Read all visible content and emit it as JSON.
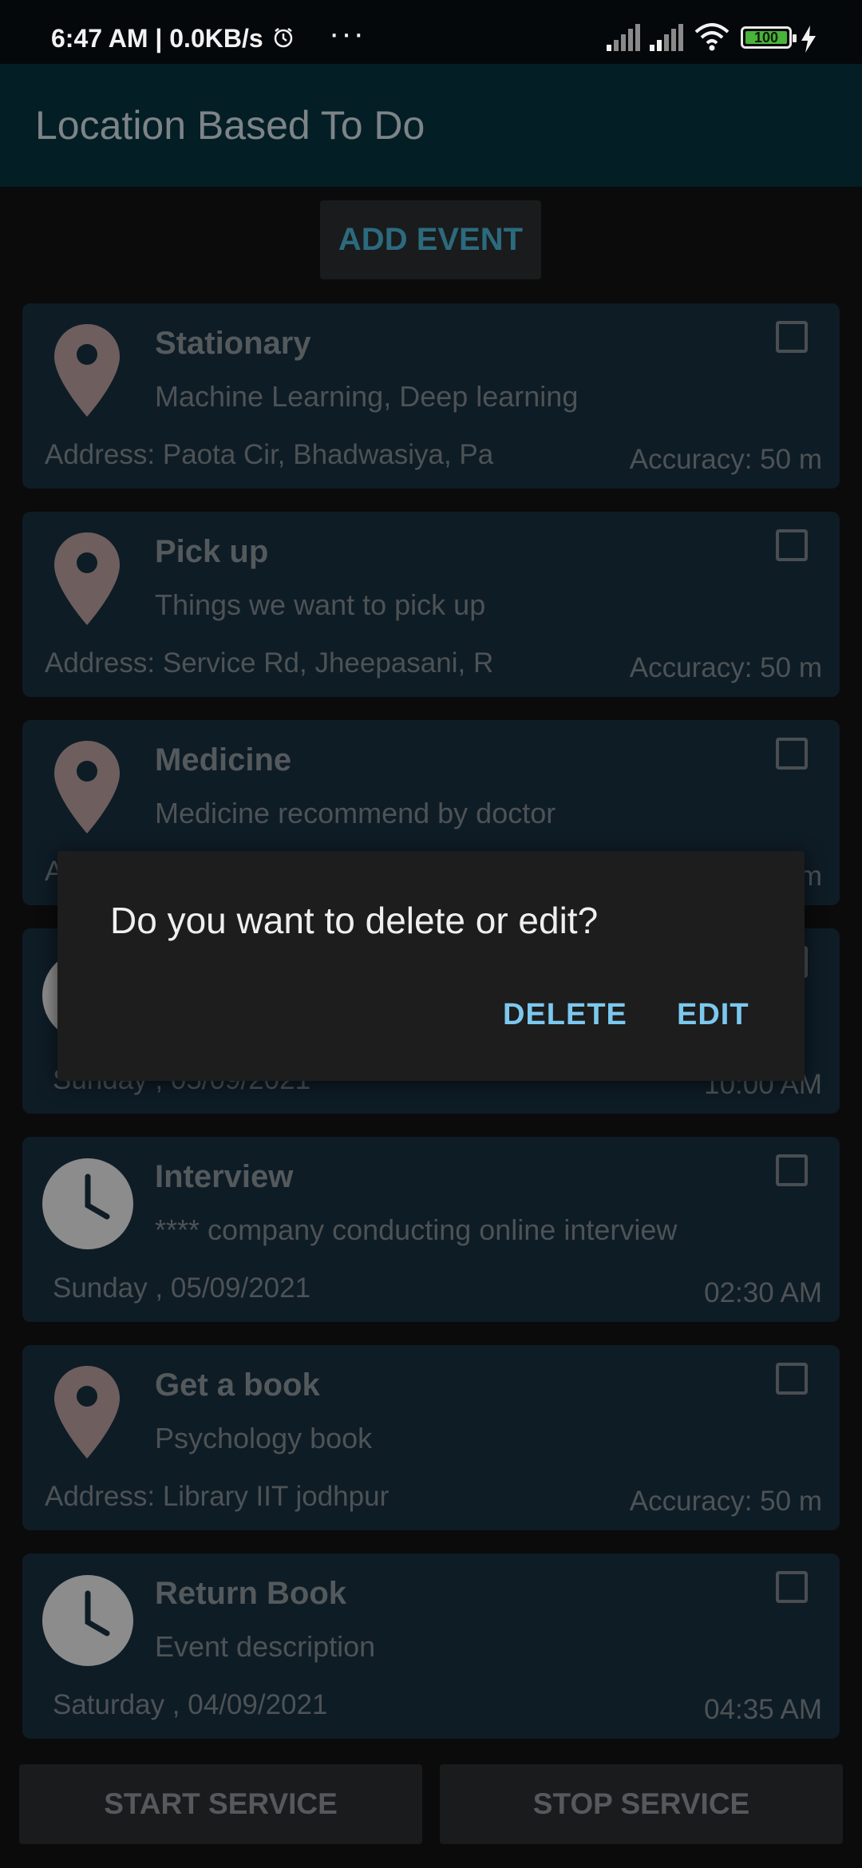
{
  "status_bar": {
    "time": "6:47 AM | 0.0KB/s",
    "dots": "···",
    "battery": "100"
  },
  "app_bar": {
    "title": "Location Based To Do"
  },
  "add_event_label": "ADD EVENT",
  "events": [
    {
      "kind": "location",
      "title": "Stationary",
      "description": "Machine Learning, Deep learning",
      "left": "Address: Paota Cir, Bhadwasiya, Pa",
      "right": "Accuracy: 50 m"
    },
    {
      "kind": "location",
      "title": "Pick up",
      "description": "Things we want to pick up",
      "left": "Address: Service Rd, Jheepasani, R",
      "right": "Accuracy: 50 m"
    },
    {
      "kind": "location",
      "title": "Medicine",
      "description": "Medicine recommend by doctor",
      "left": "A",
      "right": "m"
    },
    {
      "kind": "time",
      "title": "",
      "description": "",
      "left": "Sunday , 05/09/2021",
      "right": "10:00 AM"
    },
    {
      "kind": "time",
      "title": "Interview",
      "description": "**** company conducting online interview",
      "left": "Sunday , 05/09/2021",
      "right": "02:30 AM"
    },
    {
      "kind": "location",
      "title": "Get a book",
      "description": "Psychology book",
      "left": "Address: Library IIT jodhpur",
      "right": "Accuracy: 50 m"
    },
    {
      "kind": "time",
      "title": "Return Book",
      "description": "Event description",
      "left": "Saturday , 04/09/2021",
      "right": "04:35 AM"
    }
  ],
  "buttons": {
    "start": "START SERVICE",
    "stop": "STOP SERVICE"
  },
  "dialog": {
    "message": "Do you want to delete or edit?",
    "delete_label": "DELETE",
    "edit_label": "EDIT"
  },
  "colors": {
    "app_bar": "#041e25",
    "card": "#0e1c26",
    "dialog_action": "#7cc8ee",
    "pin": "#6e5e5e",
    "clock": "#8c8c8c"
  }
}
